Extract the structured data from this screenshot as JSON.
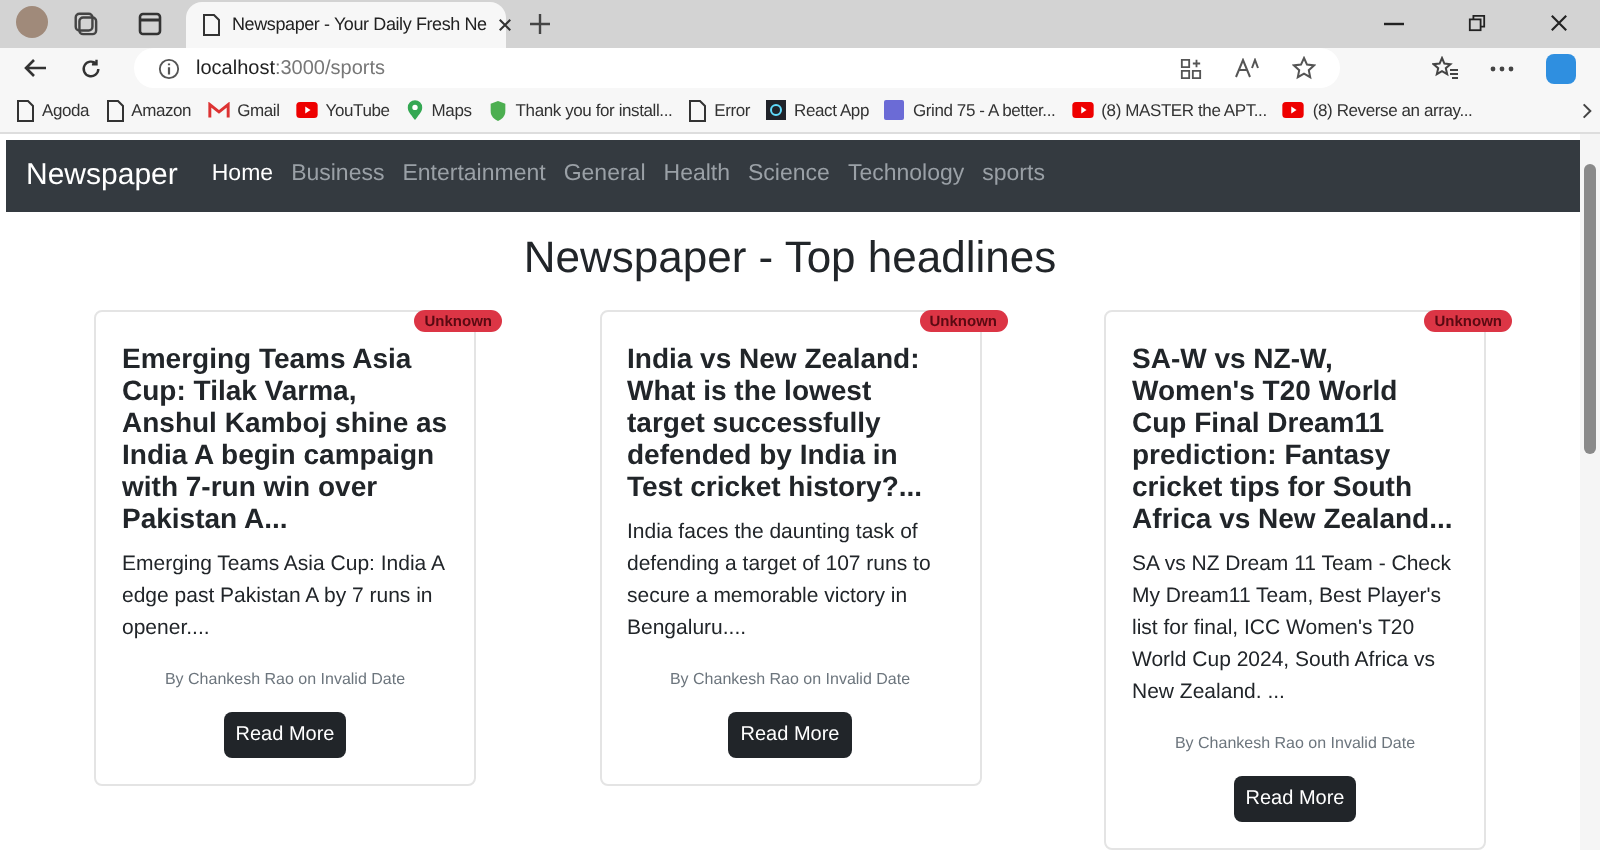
{
  "browser": {
    "tab_title": "Newspaper - Your Daily Fresh Ne",
    "address": {
      "host": "localhost",
      "path": ":3000/sports"
    },
    "bookmarks": [
      {
        "label": "Agoda",
        "kind": "page"
      },
      {
        "label": "Amazon",
        "kind": "page"
      },
      {
        "label": "Gmail",
        "kind": "mail"
      },
      {
        "label": "YouTube",
        "kind": "video"
      },
      {
        "label": "Maps",
        "kind": "pin"
      },
      {
        "label": "Thank you for install...",
        "kind": "shield"
      },
      {
        "label": "Error",
        "kind": "page"
      },
      {
        "label": "React App",
        "kind": "app"
      },
      {
        "label": "Grind 75 - A better...",
        "kind": "grind"
      },
      {
        "label": "(8) MASTER the APT...",
        "kind": "video"
      },
      {
        "label": "(8) Reverse an array...",
        "kind": "video"
      }
    ]
  },
  "navbar": {
    "brand": "Newspaper",
    "links": [
      {
        "label": "Home",
        "selected": true
      },
      {
        "label": "Business",
        "selected": false
      },
      {
        "label": "Entertainment",
        "selected": false
      },
      {
        "label": "General",
        "selected": false
      },
      {
        "label": "Health",
        "selected": false
      },
      {
        "label": "Science",
        "selected": false
      },
      {
        "label": "Technology",
        "selected": false
      },
      {
        "label": "sports",
        "selected": false
      }
    ]
  },
  "heading": "Newspaper - Top headlines",
  "articles": [
    {
      "badge": "Unknown",
      "title": "Emerging Teams Asia Cup: Tilak Varma, Anshul Kamboj shine as India A begin campaign with 7-run win over Pakistan A...",
      "description": "Emerging Teams Asia Cup: India A edge past Pakistan A by 7 runs in opener....",
      "byline": "By Chankesh Rao on Invalid Date",
      "button": "Read More"
    },
    {
      "badge": "Unknown",
      "title": "India vs New Zealand: What is the lowest target successfully defended by India in Test cricket history?...",
      "description": "India faces the daunting task of defending a target of 107 runs to secure a memorable victory in Bengaluru....",
      "byline": "By Chankesh Rao on Invalid Date",
      "button": "Read More"
    },
    {
      "badge": "Unknown",
      "title": "SA-W vs NZ-W, Women's T20 World Cup Final Dream11 prediction: Fantasy cricket tips for South Africa vs New Zealand...",
      "description": "SA vs NZ Dream 11 Team - Check My Dream11 Team, Best Player's list for final, ICC Women's T20 World Cup 2024, South Africa vs New Zealand. ...",
      "byline": "By Chankesh Rao on Invalid Date",
      "button": "Read More"
    }
  ]
}
